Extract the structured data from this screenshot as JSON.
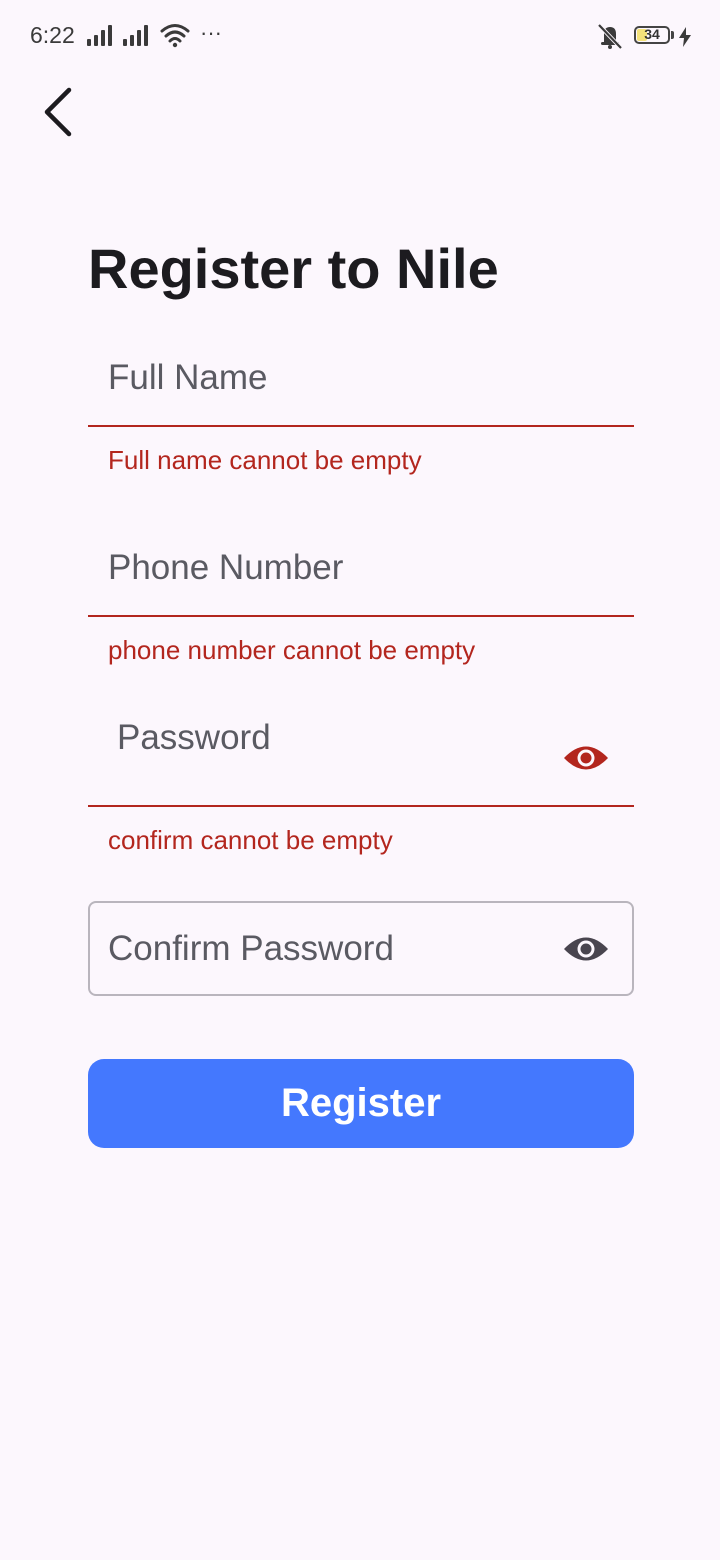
{
  "status_bar": {
    "time": "6:22",
    "overflow": "···",
    "battery": "34",
    "icons": [
      "signal-icon",
      "signal-icon",
      "wifi-icon",
      "vibrate-off-icon",
      "battery-icon",
      "charging-icon"
    ]
  },
  "header": {
    "back_icon": "chevron-left-icon"
  },
  "page": {
    "title": "Register to Nile"
  },
  "form": {
    "full_name": {
      "label": "Full Name",
      "value": "",
      "error": "Full name cannot be empty"
    },
    "phone": {
      "label": "Phone Number",
      "value": "",
      "error": "phone number cannot be empty"
    },
    "password": {
      "label": "Password",
      "value": "",
      "error": "confirm cannot be empty",
      "toggle_icon": "eye-icon"
    },
    "confirm_password": {
      "label": "Confirm Password",
      "value": "",
      "toggle_icon": "eye-icon"
    },
    "submit_label": "Register"
  },
  "colors": {
    "background": "#fcf7fd",
    "error": "#b3261e",
    "primary": "#4478fe",
    "text": "#1c1b1f",
    "label": "#5a5a62"
  }
}
